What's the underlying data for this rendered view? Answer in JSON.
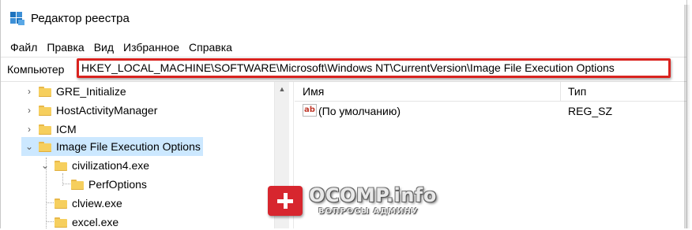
{
  "window": {
    "title": "Редактор реестра",
    "icon": "registry-editor-icon"
  },
  "menu": [
    "Файл",
    "Правка",
    "Вид",
    "Избранное",
    "Справка"
  ],
  "address": {
    "label": "Компьютер",
    "path": "HKEY_LOCAL_MACHINE\\SOFTWARE\\Microsoft\\Windows NT\\CurrentVersion\\Image File Execution Options",
    "highlight_color": "#d9231f"
  },
  "tree": {
    "items": [
      {
        "label": "GRE_Initialize",
        "expander": "collapsed"
      },
      {
        "label": "HostActivityManager",
        "expander": "collapsed"
      },
      {
        "label": "ICM",
        "expander": "collapsed"
      },
      {
        "label": "Image File Execution Options",
        "expander": "expanded",
        "selected": true
      },
      {
        "label": "civilization4.exe",
        "expander": "expanded"
      },
      {
        "label": "PerfOptions",
        "expander": "none"
      },
      {
        "label": "clview.exe",
        "expander": "none"
      },
      {
        "label": "excel.exe",
        "expander": "none"
      }
    ],
    "selected_color": "#cce8ff"
  },
  "list": {
    "columns": {
      "name": "Имя",
      "type": "Тип"
    },
    "rows": [
      {
        "name": "(По умолчанию)",
        "type": "REG_SZ",
        "icon": "string-value-icon"
      }
    ]
  },
  "watermark": {
    "title": "OCOMP.info",
    "subtitle": "ВОПРОСЫ АДМИНУ",
    "color": "#d7262e"
  }
}
